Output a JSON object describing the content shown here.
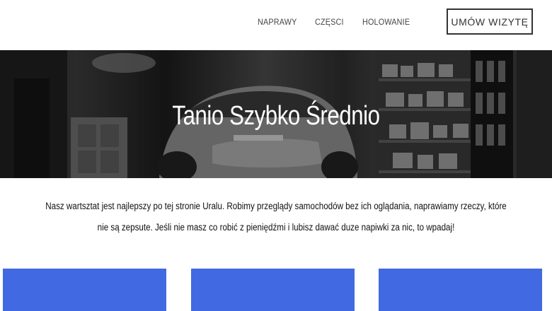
{
  "nav": {
    "links": [
      "NAPRAWY",
      "CZĘSCI",
      "HOLOWANIE"
    ],
    "cta_label": "UMÓW WIZYTĘ"
  },
  "hero": {
    "title": "Tanio Szybko Średnio",
    "image": "garage-car-photo"
  },
  "intro": {
    "text": "Nasz wartsztat jest najlepszy po tej stronie Uralu. Robimy przeglądy samochodów bez ich oglądania, naprawiamy rzeczy, które nie są zepsute. Jeśli nie masz co robić z pieniędźmi i lubisz dawać duze napiwki za nic, to wpadaj!"
  },
  "cards": {
    "color": "#4169e1",
    "count": 3
  },
  "colors": {
    "card_blue": "#4169e1",
    "cta_border": "#333333"
  }
}
